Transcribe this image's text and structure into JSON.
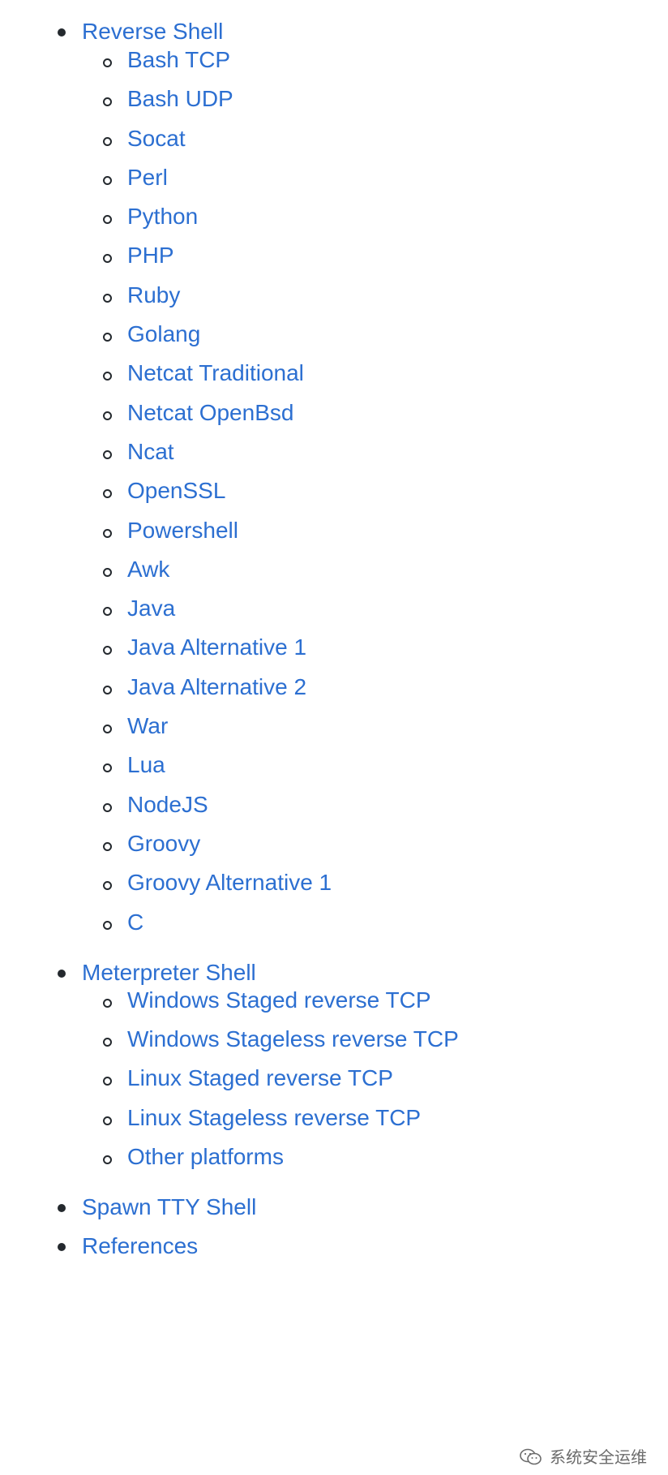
{
  "toc": [
    {
      "label": "Reverse Shell",
      "children": [
        "Bash TCP",
        "Bash UDP",
        "Socat",
        "Perl",
        "Python",
        "PHP",
        "Ruby",
        "Golang",
        "Netcat Traditional",
        "Netcat OpenBsd",
        "Ncat",
        "OpenSSL",
        "Powershell",
        "Awk",
        "Java",
        "Java Alternative 1",
        "Java Alternative 2",
        "War",
        "Lua",
        "NodeJS",
        "Groovy",
        "Groovy Alternative 1",
        "C"
      ]
    },
    {
      "label": "Meterpreter Shell",
      "children": [
        "Windows Staged reverse TCP",
        "Windows Stageless reverse TCP",
        "Linux Staged reverse TCP",
        "Linux Stageless reverse TCP",
        "Other platforms"
      ]
    },
    {
      "label": "Spawn TTY Shell",
      "children": []
    },
    {
      "label": "References",
      "children": []
    }
  ],
  "watermark": {
    "icon": "wechat-icon",
    "text": "系统安全运维"
  },
  "colors": {
    "link": "#2c6fd1",
    "bullet": "#24292e",
    "watermark": "#6b6b6b"
  }
}
